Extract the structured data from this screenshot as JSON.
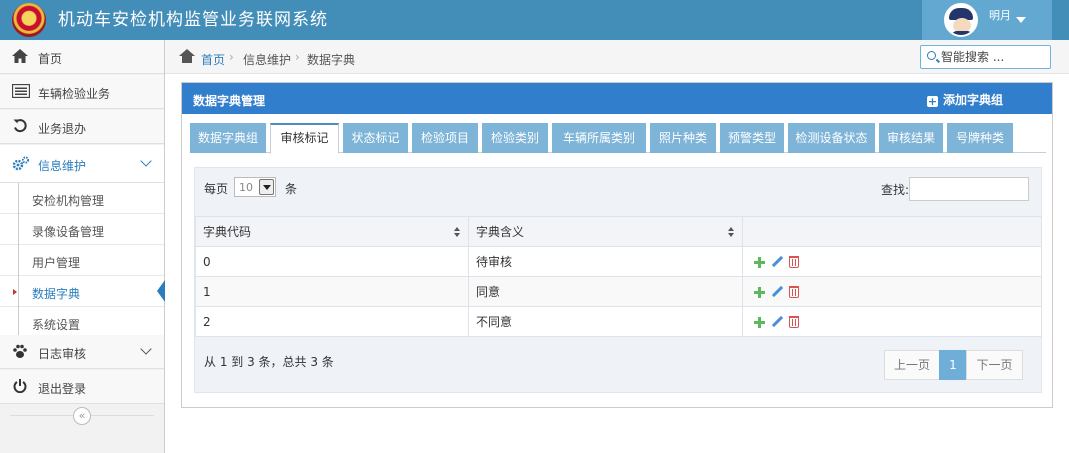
{
  "header": {
    "title": "机动车安检机构监管业务联网系统",
    "user_name": "明月"
  },
  "sidebar": {
    "items": [
      {
        "label": "首页",
        "icon": "home-icon"
      },
      {
        "label": "车辆检验业务",
        "icon": "list-icon"
      },
      {
        "label": "业务退办",
        "icon": "undo-icon"
      },
      {
        "label": "信息维护",
        "icon": "cogs-icon"
      },
      {
        "label": "日志审核",
        "icon": "paw-icon"
      },
      {
        "label": "退出登录",
        "icon": "power-icon"
      }
    ],
    "submenu": [
      {
        "label": "安检机构管理"
      },
      {
        "label": "录像设备管理"
      },
      {
        "label": "用户管理"
      },
      {
        "label": "数据字典"
      },
      {
        "label": "系统设置"
      }
    ],
    "collapse_glyph": "«"
  },
  "breadcrumb": {
    "items": [
      "首页",
      "信息维护",
      "数据字典"
    ],
    "separator": "›"
  },
  "search": {
    "placeholder": "智能搜索 ..."
  },
  "panel": {
    "title": "数据字典管理",
    "add_label": "添加字典组"
  },
  "tabs": [
    {
      "label": "数据字典组",
      "active": false
    },
    {
      "label": "审核标记",
      "active": true
    },
    {
      "label": "状态标记",
      "active": false
    },
    {
      "label": "检验项目",
      "active": false
    },
    {
      "label": "检验类别",
      "active": false
    },
    {
      "label": "车辆所属类别",
      "active": false
    },
    {
      "label": "照片种类",
      "active": false
    },
    {
      "label": "预警类型",
      "active": false
    },
    {
      "label": "检测设备状态",
      "active": false
    },
    {
      "label": "审核结果",
      "active": false
    },
    {
      "label": "号牌种类",
      "active": false
    }
  ],
  "table_controls": {
    "per_page_label": "每页",
    "per_page_value": "10",
    "per_page_unit": "条",
    "find_label": "查找:"
  },
  "table": {
    "columns": [
      "字典代码",
      "字典含义",
      ""
    ],
    "rows": [
      {
        "code": "0",
        "meaning": "待审核"
      },
      {
        "code": "1",
        "meaning": "同意"
      },
      {
        "code": "2",
        "meaning": "不同意"
      }
    ]
  },
  "footer": {
    "summary": "从 1 到 3 条，总共 3 条",
    "prev_label": "上一页",
    "current_page": "1",
    "next_label": "下一页"
  },
  "colors": {
    "header_bg": "#438eb9",
    "panel_head_bg": "#307ecc",
    "tab_bg": "#7db4d8",
    "accent": "#2b7dbc"
  }
}
